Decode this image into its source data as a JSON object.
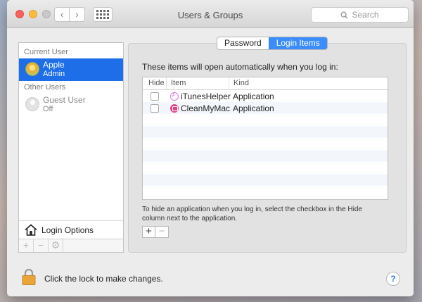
{
  "window": {
    "title": "Users & Groups",
    "search_placeholder": "Search",
    "nav_back": "‹",
    "nav_forward": "›"
  },
  "sidebar": {
    "current_user_heading": "Current User",
    "other_users_heading": "Other Users",
    "users": [
      {
        "name": "Apple",
        "role": "Admin",
        "selected": true
      },
      {
        "name": "Guest User",
        "role": "Off",
        "selected": false
      }
    ],
    "login_options_label": "Login Options",
    "add_label": "+",
    "remove_label": "−"
  },
  "tabs": [
    {
      "label": "Password",
      "active": false
    },
    {
      "label": "Login Items",
      "active": true
    }
  ],
  "login_items": {
    "intro": "These items will open automatically when you log in:",
    "columns": [
      "Hide",
      "Item",
      "Kind"
    ],
    "rows": [
      {
        "item": "iTunesHelper",
        "kind": "Application",
        "hide": false,
        "icon": "itunes-icon"
      },
      {
        "item": "CleanMyMac",
        "kind": "Application",
        "hide": false,
        "icon": "cleanmymac-icon"
      }
    ],
    "hint": "To hide an application when you log in, select the checkbox in the Hide column next to the application.",
    "add_label": "+",
    "remove_label": "−"
  },
  "footer": {
    "lock_text": "Click the lock to make changes.",
    "help_label": "?"
  },
  "colors": {
    "selection": "#1d6ee8",
    "tab_active": "#3b8dfb",
    "lock": "#e9a43a",
    "help": "#2f78e6"
  }
}
